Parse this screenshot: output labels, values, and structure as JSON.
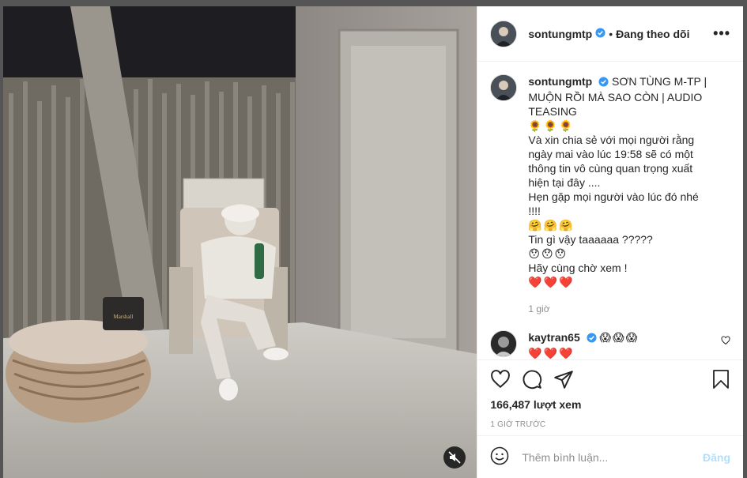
{
  "header": {
    "username": "sontungmtp",
    "separator": "•",
    "follow_label": "Đang theo dõi",
    "more_label": "•••"
  },
  "caption": {
    "username": "sontungmtp",
    "lines": [
      "SƠN TÙNG M-TP |",
      "MUỘN RỒI MÀ SAO CÒN | AUDIO",
      "TEASING",
      "🌻🌻🌻",
      "Và xin chia sẻ với mọi người rằng",
      "ngày mai vào lúc 19:58 sẽ có một",
      "thông tin vô cùng quan trọng xuất",
      "hiện tại đây ....",
      "Hẹn gặp mọi người vào lúc đó nhé !!!!",
      "🤗🤗🤗",
      "Tin gì vậy taaaaaa ?????",
      "😯😯😯",
      "Hãy cùng chờ xem !",
      "❤️❤️❤️"
    ],
    "time": "1 giờ"
  },
  "reply": {
    "username": "kaytran65",
    "emojis": "😱😱😱",
    "text": "❤️❤️❤️"
  },
  "stats": {
    "views": "166,487 lượt xem",
    "posted": "1 GIỜ TRƯỚC"
  },
  "composer": {
    "placeholder": "Thêm bình luận...",
    "post_label": "Đăng"
  },
  "colors": {
    "verified": "#3897f0",
    "muted_text": "#8e8e8e",
    "post_disabled": "#b2dffc"
  },
  "icons": {
    "more": "more-options-icon",
    "like": "heart-icon",
    "comment": "comment-icon",
    "share": "share-icon",
    "save": "bookmark-icon",
    "emoji": "emoji-icon",
    "mute": "speaker-muted-icon"
  }
}
